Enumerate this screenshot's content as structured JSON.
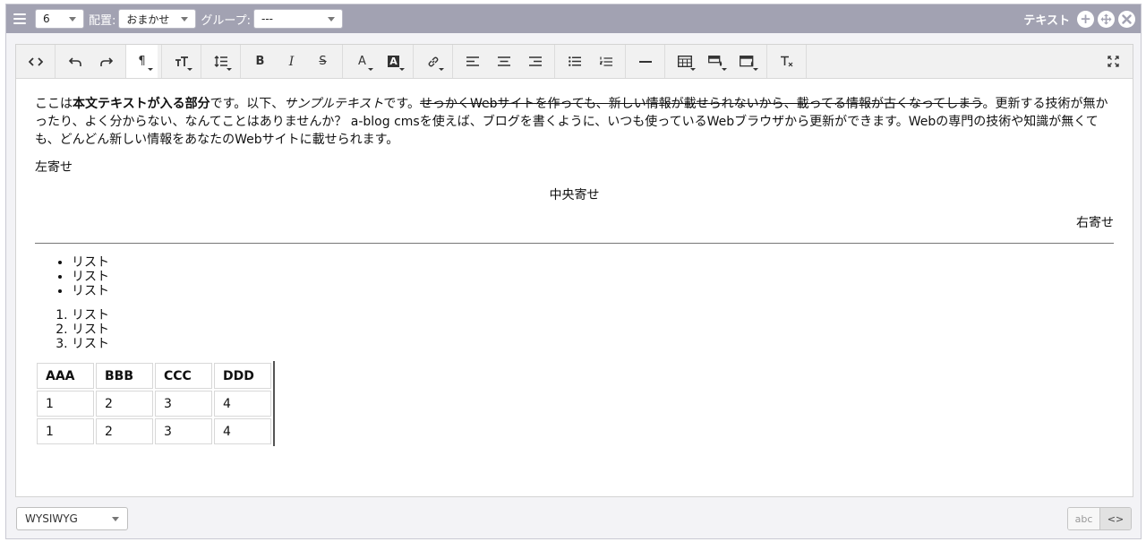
{
  "header": {
    "column_value": "6",
    "align_label": "配置:",
    "align_value": "おまかせ",
    "group_label": "グループ:",
    "group_value": "---",
    "unit_type": "テキスト"
  },
  "content": {
    "p1_a": "ここは",
    "p1_bold": "本文テキストが入る部分",
    "p1_b": "です。以下、",
    "p1_italic": "サンプルテキスト",
    "p1_c": "です。",
    "p1_strike": "せっかくWebサイトを作っても、新しい情報が載せられないから、載ってる情報が古くなってしまう",
    "p1_d": "。更新する技術が無かったり、よく分からない、なんてことはありませんか？ a-blog cmsを使えば、ブログを書くように、いつも使っているWebブラウザから更新ができます。Webの専門の技術や知識が無くても、どんどん新しい情報をあなたのWebサイトに載せられます。",
    "left": "左寄せ",
    "center": "中央寄せ",
    "right": "右寄せ",
    "ul": [
      "リスト",
      "リスト",
      "リスト"
    ],
    "ol": [
      "リスト",
      "リスト",
      "リスト"
    ],
    "table": {
      "headers": [
        "AAA",
        "BBB",
        "CCC",
        "DDD"
      ],
      "rows": [
        [
          "1",
          "2",
          "3",
          "4"
        ],
        [
          "1",
          "2",
          "3",
          "4"
        ]
      ]
    }
  },
  "footer": {
    "editor_mode": "WYSIWYG",
    "toggle_text": "abc",
    "toggle_code": "<>"
  }
}
